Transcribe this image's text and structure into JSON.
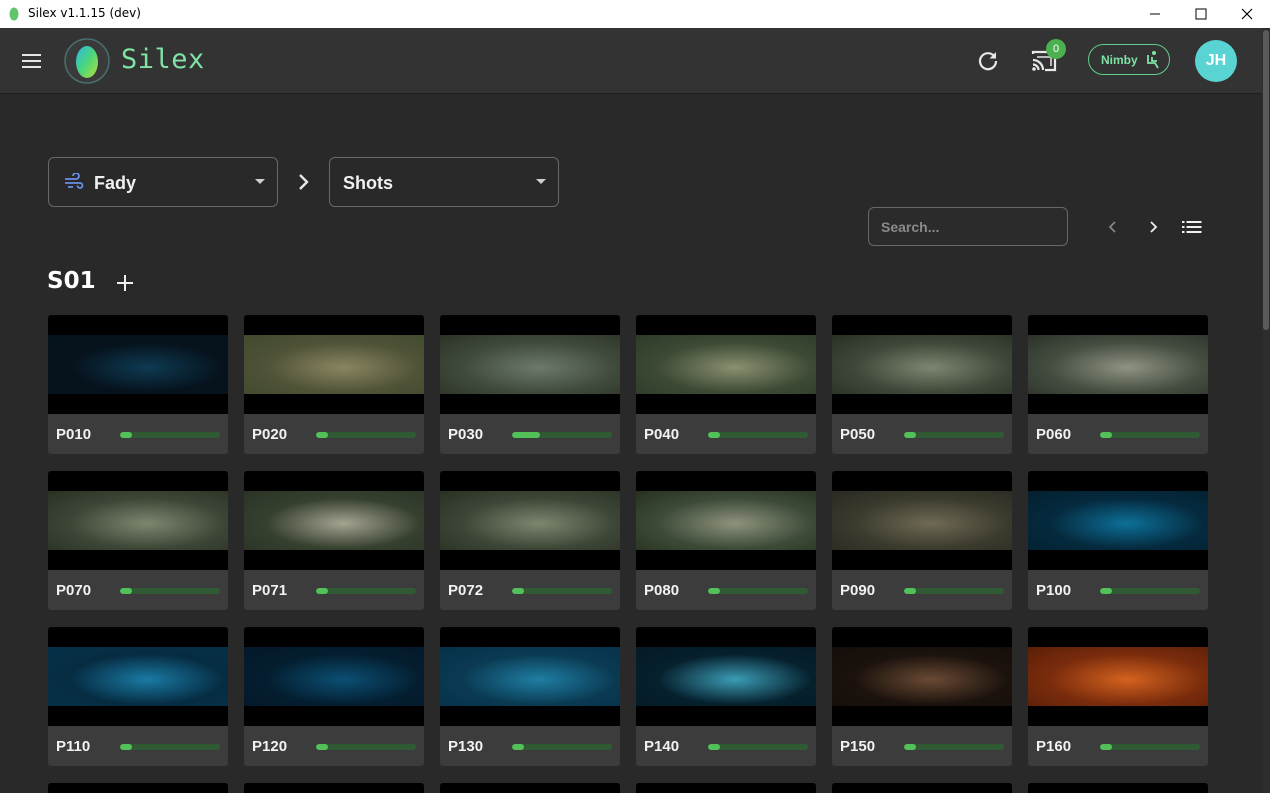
{
  "window": {
    "title": "Silex v1.1.15 (dev)",
    "minimize_icon": "minimize-icon",
    "maximize_icon": "maximize-icon",
    "close_icon": "close-icon"
  },
  "header": {
    "logo_text": "Silex",
    "cast_badge_count": "0",
    "nimby_label": "Nimby",
    "avatar_initials": "JH",
    "accent": "#7fe3a4"
  },
  "breadcrumb": {
    "project": "Fady",
    "category": "Shots"
  },
  "search": {
    "placeholder": "Search..."
  },
  "section": {
    "title": "S01"
  },
  "shots": [
    {
      "name": "P010",
      "progress": 0.12,
      "colors": [
        "#06121c",
        "#0e3a52",
        "#05131d"
      ]
    },
    {
      "name": "P020",
      "progress": 0.12,
      "colors": [
        "#4f5237",
        "#8a8560",
        "#3e4a2c"
      ]
    },
    {
      "name": "P030",
      "progress": 0.28,
      "colors": [
        "#3f4a3c",
        "#6d7a6b",
        "#2b3226"
      ]
    },
    {
      "name": "P040",
      "progress": 0.12,
      "colors": [
        "#3d4a35",
        "#8a9070",
        "#2c3a28"
      ]
    },
    {
      "name": "P050",
      "progress": 0.12,
      "colors": [
        "#3e4738",
        "#7d8670",
        "#283022"
      ]
    },
    {
      "name": "P060",
      "progress": 0.12,
      "colors": [
        "#444d40",
        "#8f9382",
        "#2c3129"
      ]
    },
    {
      "name": "P070",
      "progress": 0.12,
      "colors": [
        "#3d4636",
        "#7e8670",
        "#283022"
      ]
    },
    {
      "name": "P071",
      "progress": 0.12,
      "colors": [
        "#36402f",
        "#a5a391",
        "#2a3325"
      ]
    },
    {
      "name": "P072",
      "progress": 0.12,
      "colors": [
        "#3d4636",
        "#7e8670",
        "#283022"
      ]
    },
    {
      "name": "P080",
      "progress": 0.12,
      "colors": [
        "#3c4b38",
        "#8e927d",
        "#27301f"
      ]
    },
    {
      "name": "P090",
      "progress": 0.12,
      "colors": [
        "#3b3a2d",
        "#6f6a55",
        "#2a2921"
      ]
    },
    {
      "name": "P100",
      "progress": 0.12,
      "colors": [
        "#052a3e",
        "#0d6f98",
        "#04202f"
      ]
    },
    {
      "name": "P110",
      "progress": 0.12,
      "colors": [
        "#062c42",
        "#1a7aa4",
        "#053047"
      ]
    },
    {
      "name": "P120",
      "progress": 0.12,
      "colors": [
        "#041e30",
        "#0b4f73",
        "#04182a"
      ]
    },
    {
      "name": "P130",
      "progress": 0.12,
      "colors": [
        "#0a3a52",
        "#1f7ea3",
        "#063049"
      ]
    },
    {
      "name": "P140",
      "progress": 0.12,
      "colors": [
        "#06202d",
        "#3b9cb5",
        "#051a26"
      ]
    },
    {
      "name": "P150",
      "progress": 0.12,
      "colors": [
        "#1b120d",
        "#6a4a34",
        "#140d09"
      ]
    },
    {
      "name": "P160",
      "progress": 0.12,
      "colors": [
        "#7a2c0c",
        "#d4621f",
        "#5a1f08"
      ]
    }
  ]
}
